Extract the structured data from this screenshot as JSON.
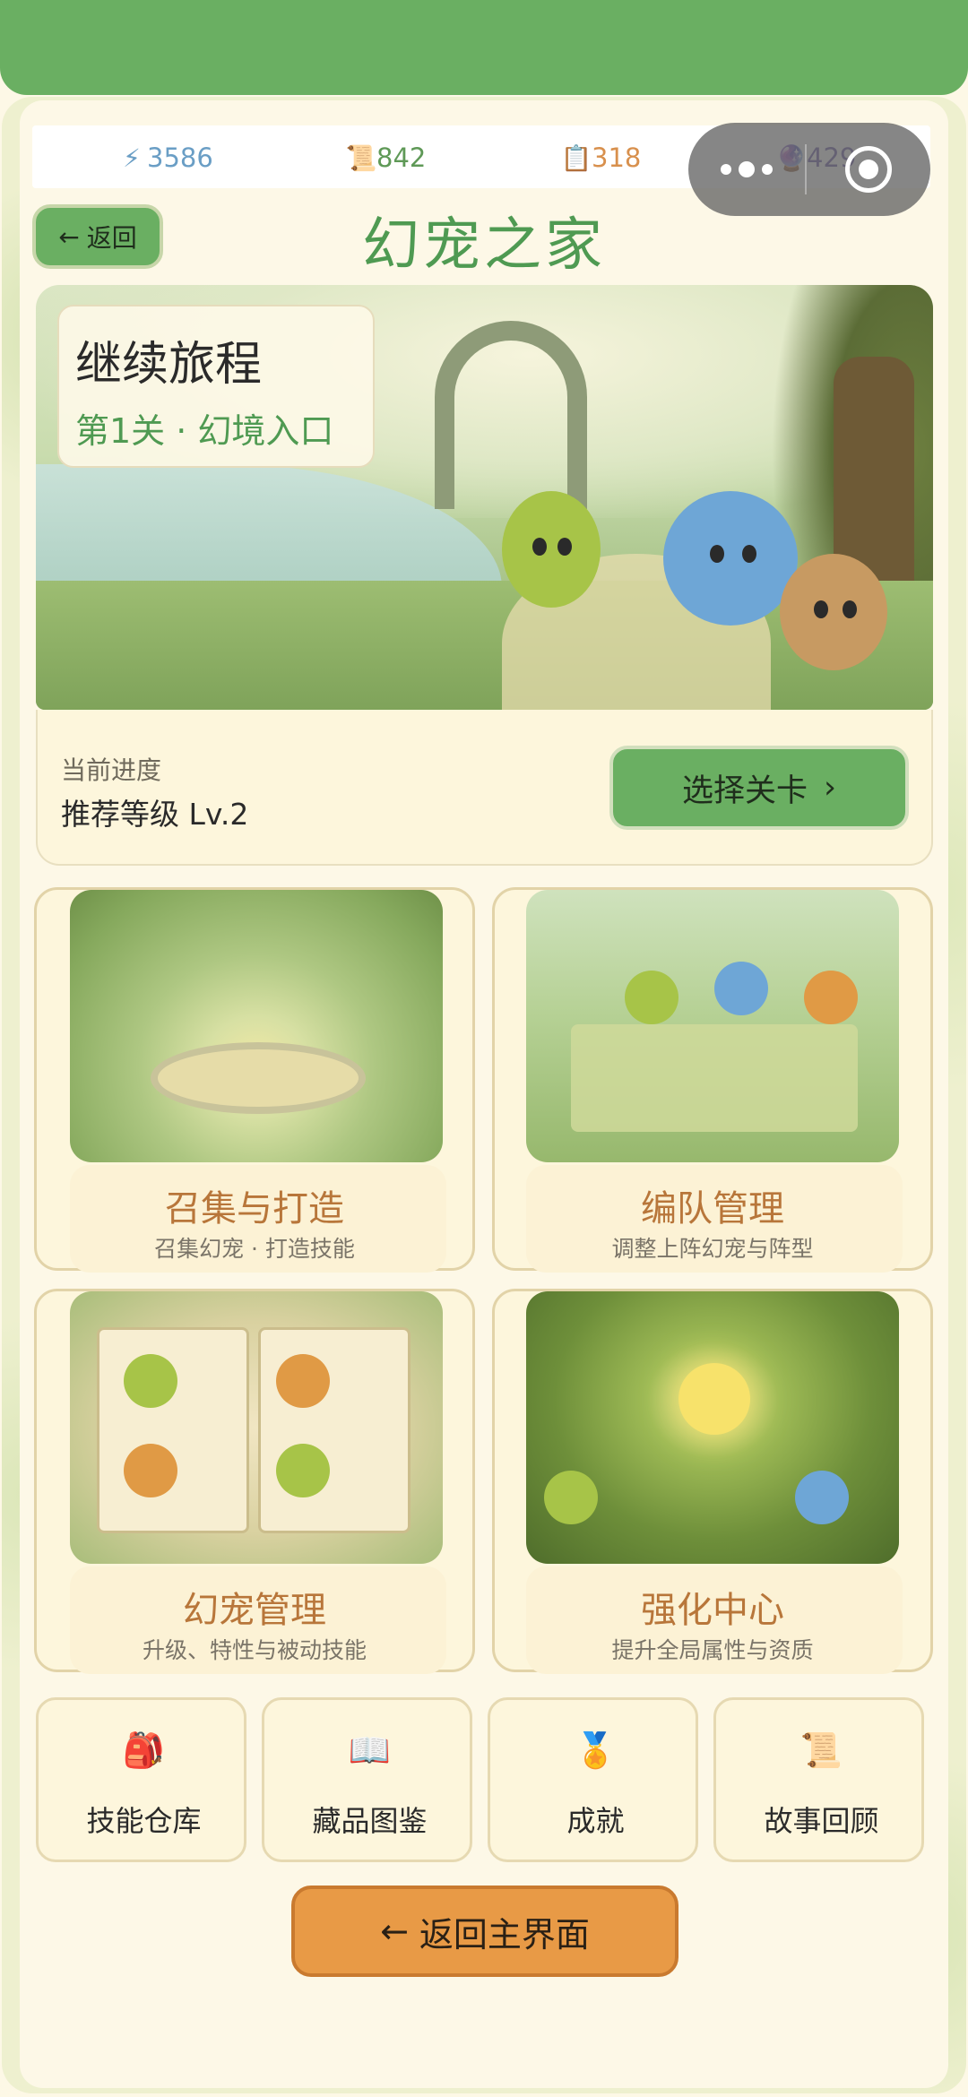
{
  "resources": [
    {
      "icon": "lightning-icon",
      "glyph": "⚡",
      "value": "3586"
    },
    {
      "icon": "scroll-icon",
      "glyph": "📜",
      "value": "842"
    },
    {
      "icon": "clipboard-icon",
      "glyph": "📋",
      "value": "318"
    },
    {
      "icon": "orb-icon",
      "glyph": "🔮",
      "value": "429"
    }
  ],
  "header": {
    "back_label": "返回",
    "back_arrow": "←",
    "title": "幻宠之家"
  },
  "journey": {
    "title": "继续旅程",
    "stage": "第1关 · 幻境入口",
    "progress_label": "当前进度",
    "recommended": "推荐等级 Lv.2",
    "select_label": "选择关卡",
    "select_arrow": "›"
  },
  "features": [
    {
      "title": "召集与打造",
      "subtitle": "召集幻宠 · 打造技能"
    },
    {
      "title": "编队管理",
      "subtitle": "调整上阵幻宠与阵型"
    },
    {
      "title": "幻宠管理",
      "subtitle": "升级、特性与被动技能"
    },
    {
      "title": "强化中心",
      "subtitle": "提升全局属性与资质"
    }
  ],
  "shortcuts": [
    {
      "icon": "backpack-icon",
      "glyph": "🎒",
      "label": "技能仓库"
    },
    {
      "icon": "book-icon",
      "glyph": "📖",
      "label": "藏品图鉴"
    },
    {
      "icon": "medal-icon",
      "glyph": "🏅",
      "label": "成就"
    },
    {
      "icon": "scroll-icon",
      "glyph": "📜",
      "label": "故事回顾"
    }
  ],
  "footer": {
    "main_label": "返回主界面",
    "main_arrow": "←"
  },
  "colors": {
    "accent_green": "#6aaf62",
    "title_green": "#4f9a52",
    "feature_title": "#b8763a",
    "main_button": "#e89a46"
  }
}
